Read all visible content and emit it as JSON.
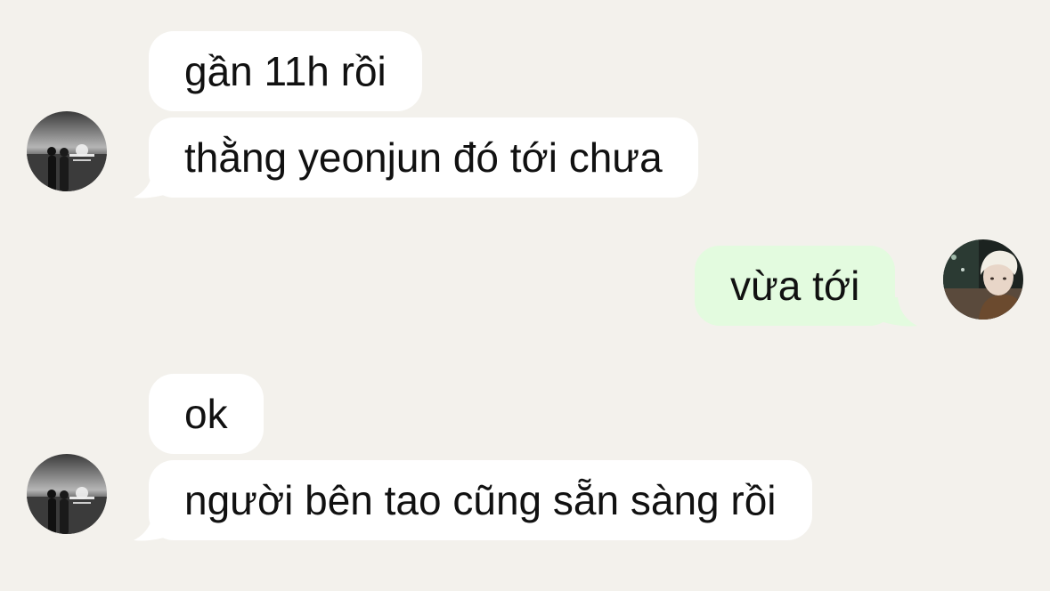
{
  "messages": [
    {
      "sender": "friend",
      "text": "gần 11h rồi"
    },
    {
      "sender": "friend",
      "text": "thằng yeonjun đó tới chưa"
    },
    {
      "sender": "me",
      "text": "vừa tới"
    },
    {
      "sender": "friend",
      "text": "ok"
    },
    {
      "sender": "friend",
      "text": "người bên tao cũng sẵn sàng rồi"
    }
  ],
  "colors": {
    "background": "#f3f1ec",
    "incoming_bubble": "#ffffff",
    "outgoing_bubble": "#e3fbdf",
    "text": "#111111"
  },
  "avatars": {
    "friend": "grayscale-sunset-couple-photo",
    "me": "blonde-person-night-photo"
  }
}
